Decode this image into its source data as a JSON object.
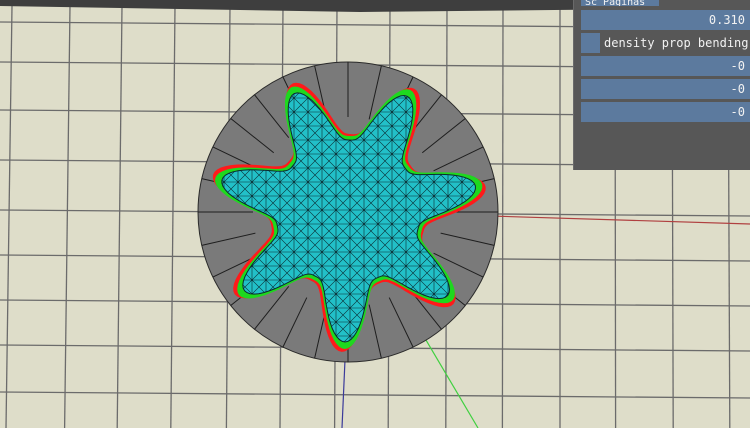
{
  "panel": {
    "tab_label": "Sc Paginas",
    "value_1": "0.310",
    "checkbox_label": "density prop bending",
    "checkbox_checked": false,
    "value_2": "-0",
    "value_3": "-0",
    "value_4": "-0"
  },
  "scene": {
    "background": "#deddc9",
    "grid_color": "#6b6b6b",
    "gear_color": "#7a7a7a",
    "mesh_fill": "#22c0c8",
    "mesh_line": "#0a2a30",
    "mesh_edge_colors": [
      "#ff1a1a",
      "#1ed81e"
    ],
    "axis_colors": {
      "x": "#b04040",
      "y": "#3a3a9a",
      "z": "#40d040"
    }
  }
}
